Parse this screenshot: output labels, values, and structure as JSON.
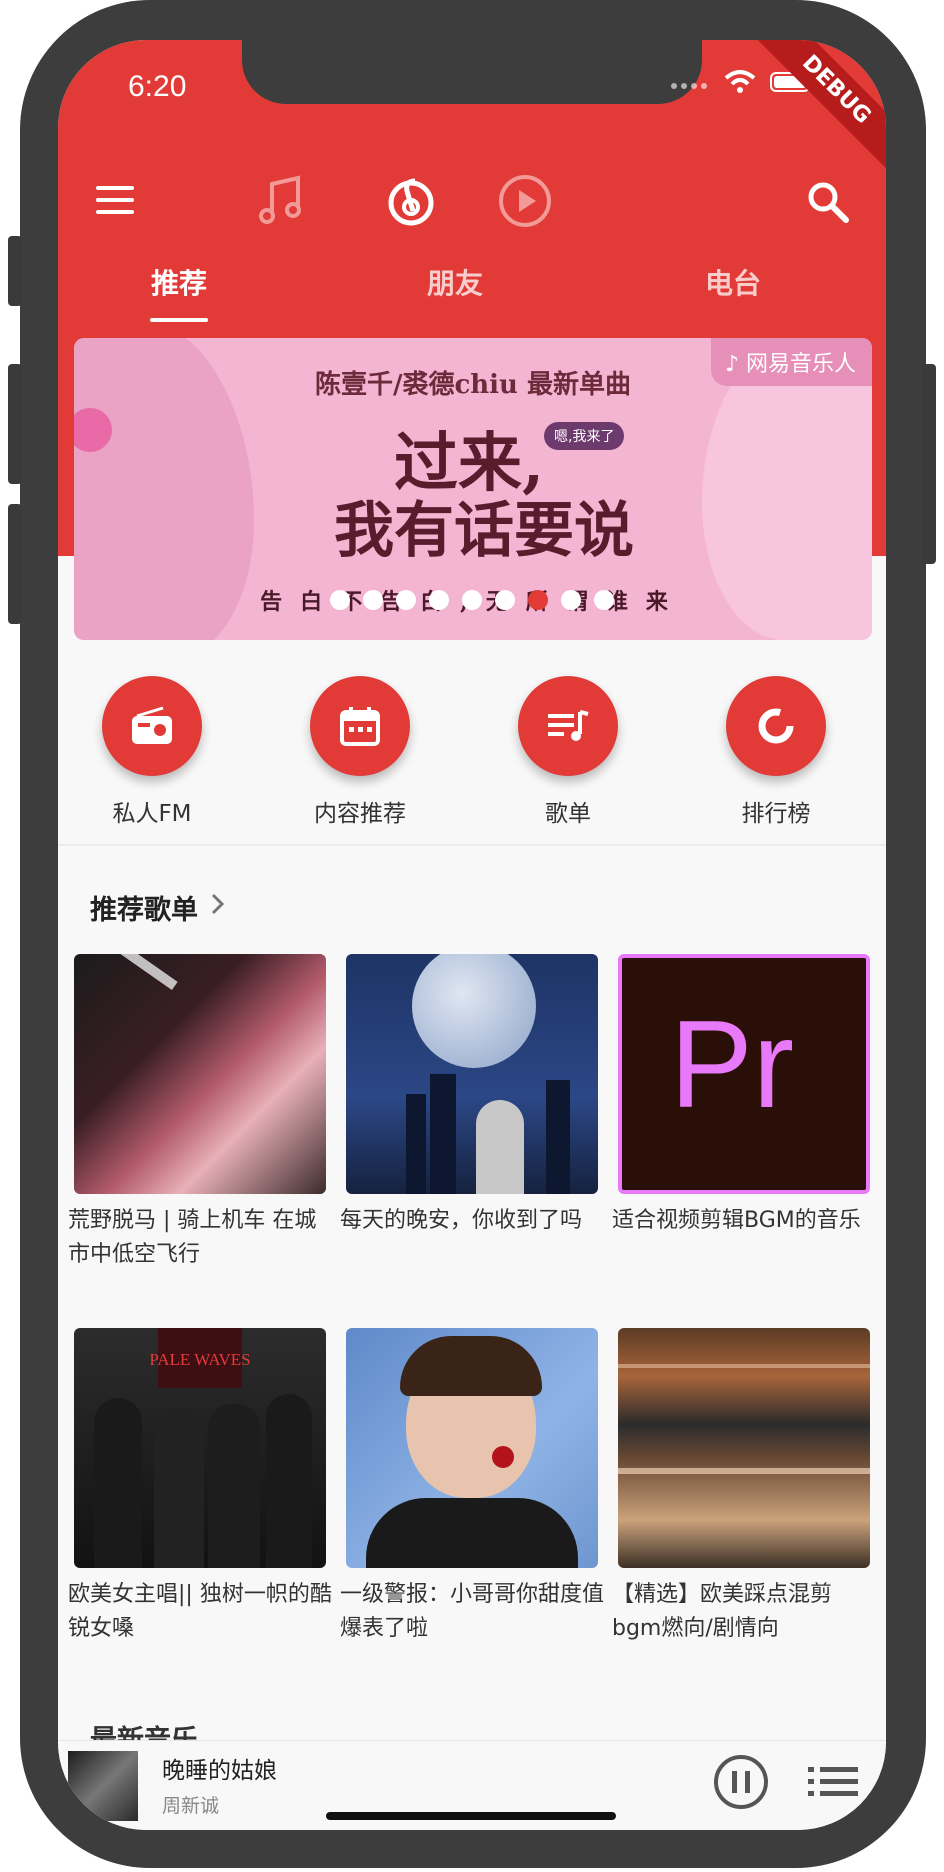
{
  "status": {
    "time": "6:20",
    "debug_label": "DEBUG"
  },
  "header": {
    "tabs": [
      {
        "label": "推荐"
      },
      {
        "label": "朋友"
      },
      {
        "label": "电台"
      }
    ]
  },
  "banner": {
    "headline": "陈壹千/裘德chiu 最新单曲",
    "title_line1": "过来,",
    "title_line2": "我有话要说",
    "bubble": "嗯,我来了",
    "footer": "告白不告白,无所谓谁来",
    "brand": "♪ 网易音乐人",
    "dots_total": 9,
    "dots_active_index": 6
  },
  "quick_actions": [
    {
      "label": "私人FM",
      "icon": "radio-icon"
    },
    {
      "label": "内容推荐",
      "icon": "calendar-icon"
    },
    {
      "label": "歌单",
      "icon": "playlist-icon"
    },
    {
      "label": "排行榜",
      "icon": "ranking-icon"
    }
  ],
  "recommended": {
    "section_title": "推荐歌单",
    "playlists": [
      {
        "title": "荒野脱马 | 骑上机车 在城市中低空飞行"
      },
      {
        "title": "每天的晚安，你收到了吗"
      },
      {
        "title": "适合视频剪辑BGM的音乐"
      },
      {
        "title": "欧美女主唱|| 独树一帜的酷锐女嗓"
      },
      {
        "title": "一级警报：小哥哥你甜度值爆表了啦"
      },
      {
        "title": "【精选】欧美踩点混剪bgm燃向/剧情向"
      }
    ],
    "pr_logo": "Pr",
    "band_poster": "PALE WAVES"
  },
  "next_section": {
    "title": "最新音乐"
  },
  "player": {
    "song": "晚睡的姑娘",
    "artist": "周新诚"
  },
  "colors": {
    "accent": "#e23b37"
  }
}
